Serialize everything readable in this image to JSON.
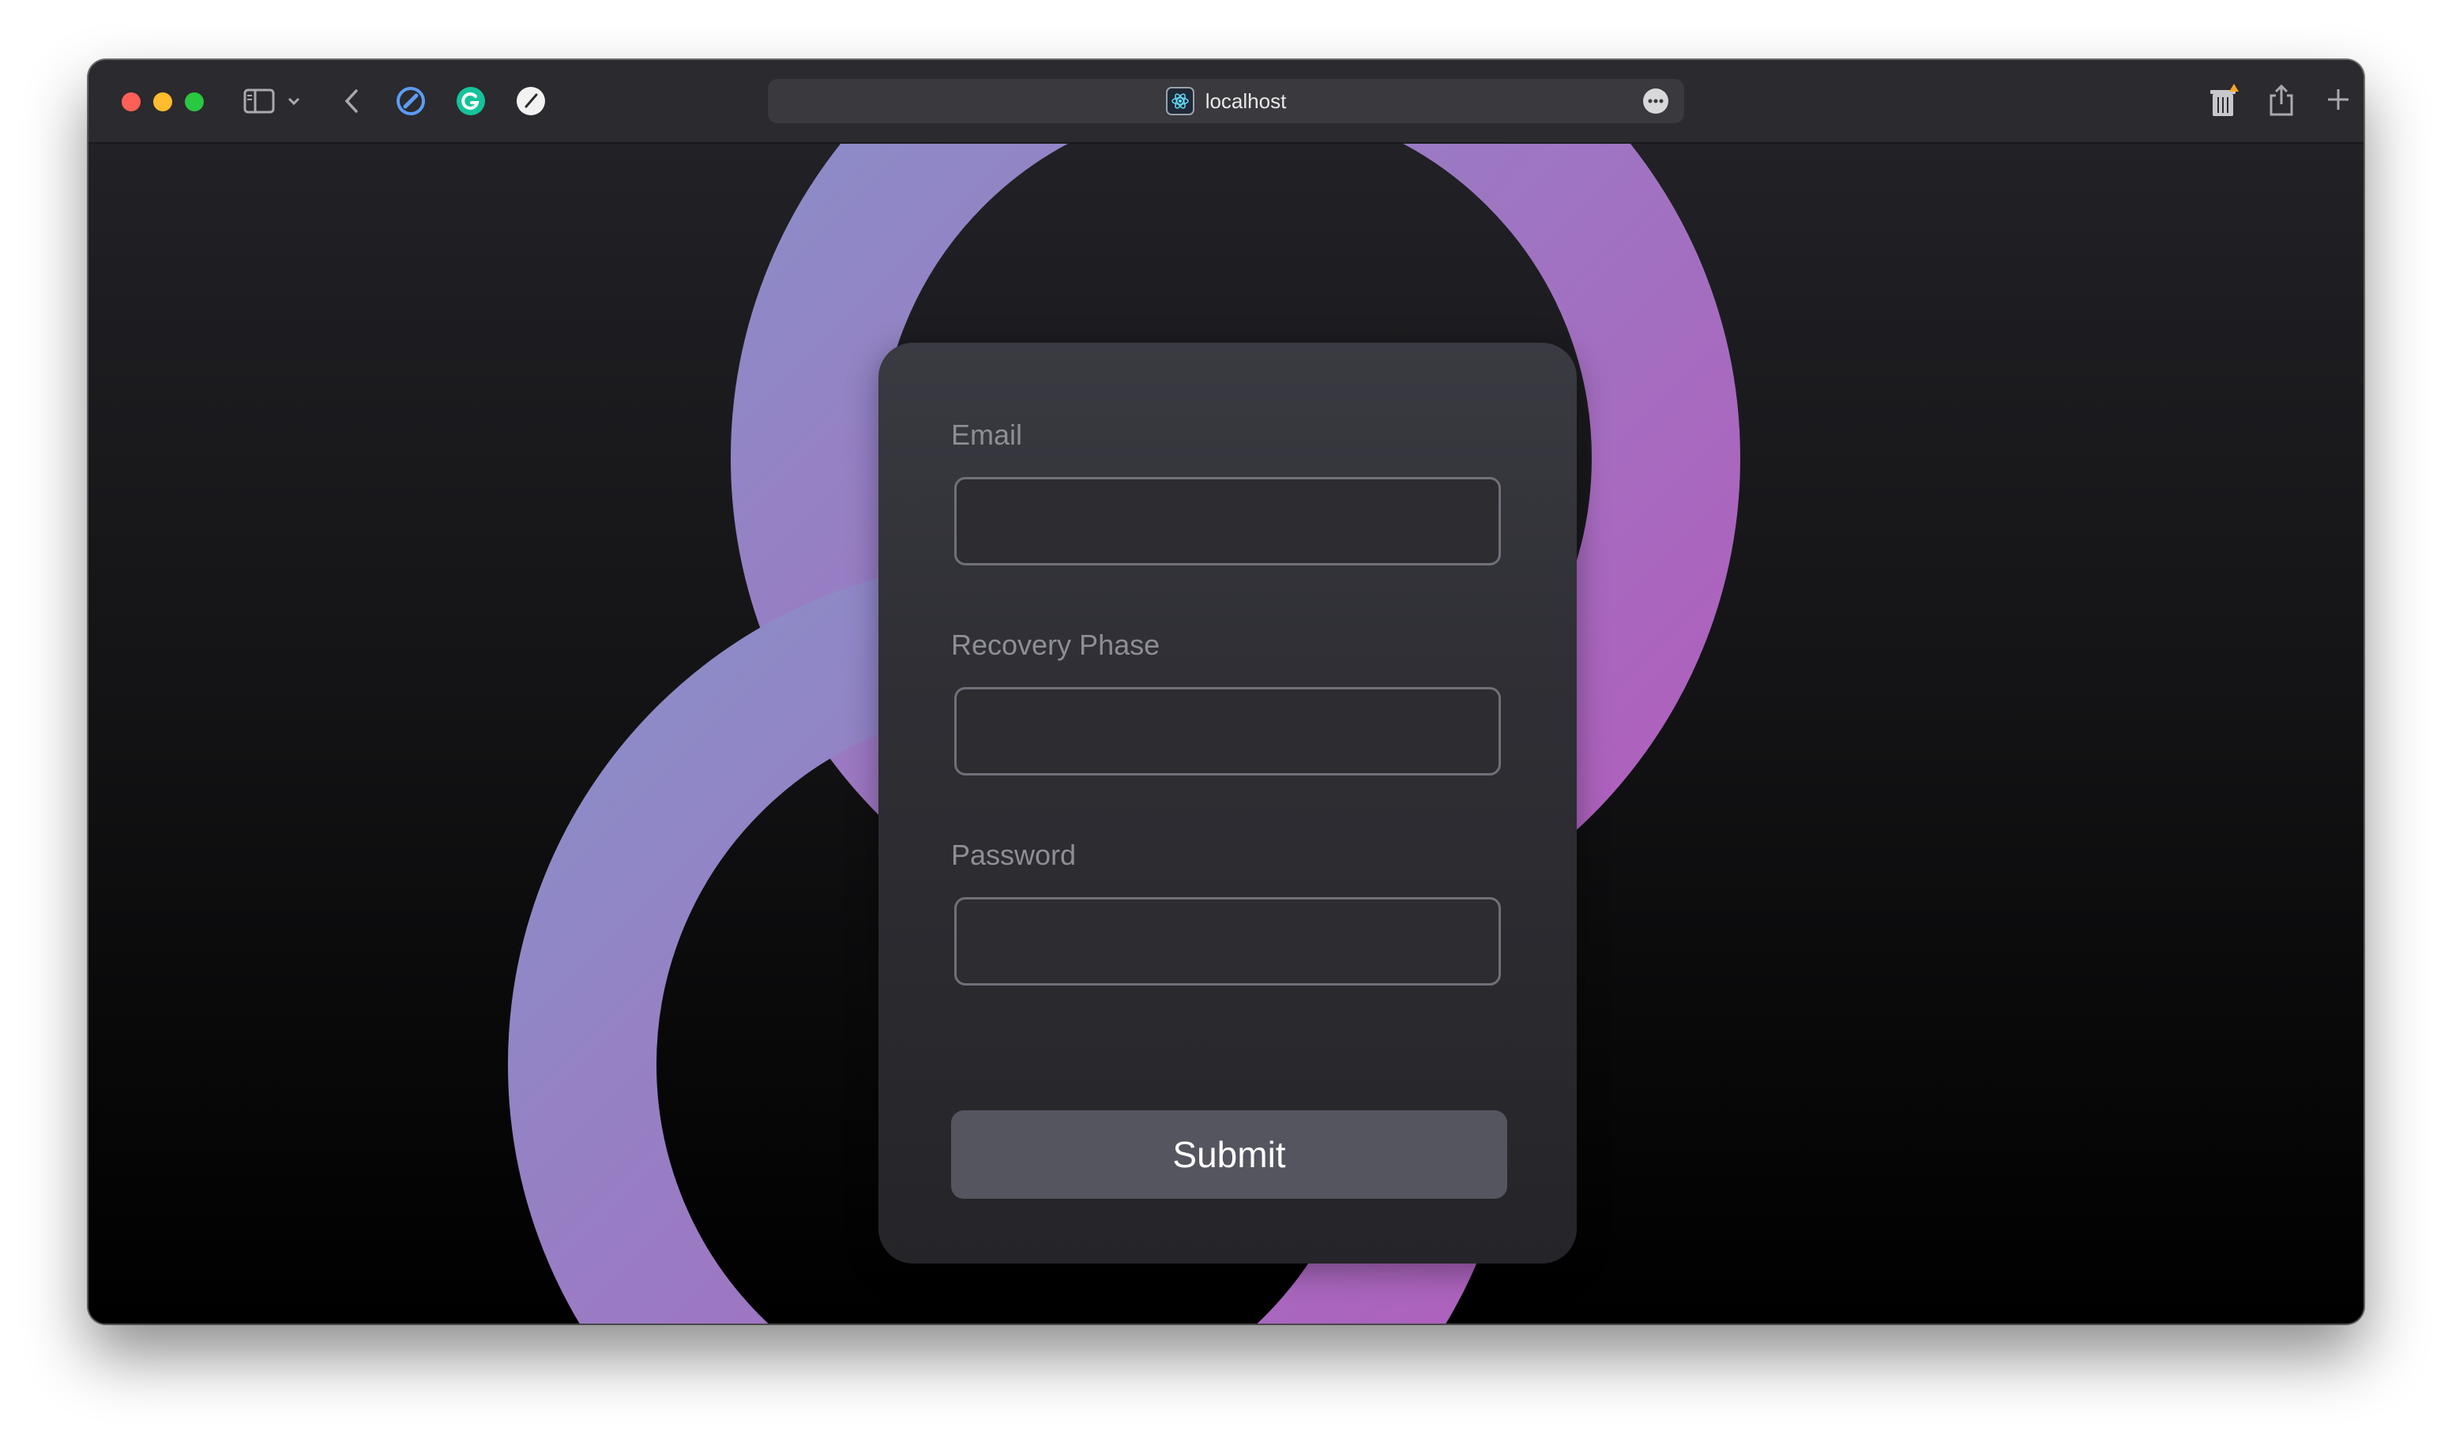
{
  "browser": {
    "url": "localhost",
    "icons": {
      "sidebar": "sidebar-icon",
      "chevron": "chevron-down-icon",
      "back": "back-arrow-icon",
      "ext1": "compass-icon",
      "ext2": "grammarly-icon",
      "ext3": "pen-icon",
      "reader": "ellipsis-icon",
      "trash": "trash-icon",
      "share": "share-icon",
      "new_tab": "plus-icon"
    },
    "traffic_colors": {
      "close": "#fe5f57",
      "minimize": "#febc2e",
      "maximize": "#28c840"
    }
  },
  "form": {
    "email_label": "Email",
    "email_value": "",
    "recovery_label": "Recovery Phase",
    "recovery_value": "",
    "password_label": "Password",
    "password_value": "",
    "submit_label": "Submit"
  },
  "theme": {
    "ring_gradient_start": "#8a8fc8",
    "ring_gradient_end": "#b15dbc"
  }
}
